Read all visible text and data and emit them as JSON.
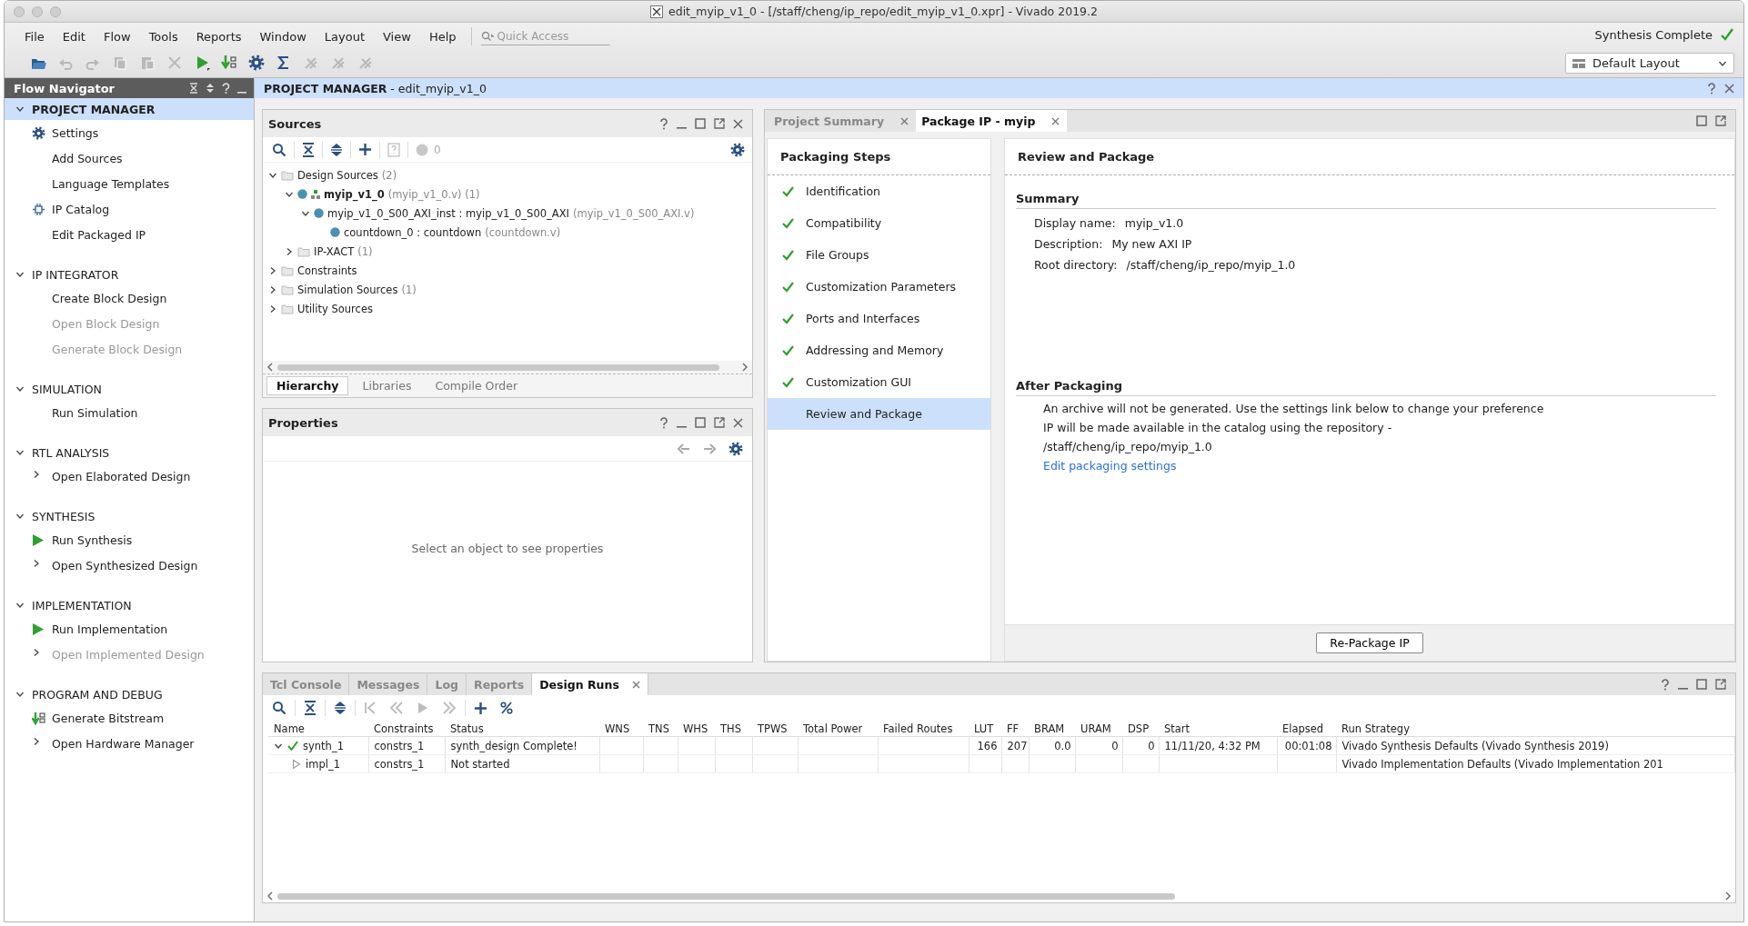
{
  "window": {
    "title": "edit_myip_v1_0 - [/staff/cheng/ip_repo/edit_myip_v1_0.xpr] - Vivado 2019.2"
  },
  "menu": [
    "File",
    "Edit",
    "Flow",
    "Tools",
    "Reports",
    "Window",
    "Layout",
    "View",
    "Help"
  ],
  "quick_access": {
    "placeholder": "Quick Access"
  },
  "toolbar": [
    {
      "kind": "open",
      "disabled": false
    },
    {
      "kind": "undo",
      "disabled": true
    },
    {
      "kind": "redo",
      "disabled": true
    },
    {
      "kind": "copy",
      "disabled": true
    },
    {
      "kind": "paste",
      "disabled": true
    },
    {
      "kind": "delete",
      "disabled": true
    },
    {
      "kind": "run",
      "disabled": false
    },
    {
      "kind": "bitstream",
      "disabled": false
    },
    {
      "kind": "settings",
      "disabled": false
    },
    {
      "kind": "sigma",
      "disabled": false
    },
    {
      "kind": "tool",
      "disabled": true
    },
    {
      "kind": "tool",
      "disabled": true
    },
    {
      "kind": "tool",
      "disabled": true
    }
  ],
  "status": {
    "text": "Synthesis Complete",
    "complete": true
  },
  "layout_select": {
    "value": "Default Layout"
  },
  "flow_navigator": {
    "title": "Flow Navigator",
    "sections": [
      {
        "label": "PROJECT MANAGER",
        "expanded": true,
        "selected": true,
        "items": [
          {
            "label": "Settings",
            "kind": "settings",
            "expandable": false,
            "disabled": false
          },
          {
            "label": "Add Sources",
            "kind": "plain",
            "expandable": false,
            "disabled": false
          },
          {
            "label": "Language Templates",
            "kind": "plain",
            "expandable": false,
            "disabled": false
          },
          {
            "label": "IP Catalog",
            "kind": "catalog",
            "expandable": false,
            "disabled": false
          },
          {
            "label": "Edit Packaged IP",
            "kind": "plain",
            "expandable": false,
            "disabled": false
          }
        ]
      },
      {
        "label": "IP INTEGRATOR",
        "expanded": true,
        "selected": false,
        "items": [
          {
            "label": "Create Block Design",
            "kind": "plain",
            "expandable": false,
            "disabled": false
          },
          {
            "label": "Open Block Design",
            "kind": "plain",
            "expandable": false,
            "disabled": true
          },
          {
            "label": "Generate Block Design",
            "kind": "plain",
            "expandable": false,
            "disabled": true
          }
        ]
      },
      {
        "label": "SIMULATION",
        "expanded": true,
        "selected": false,
        "items": [
          {
            "label": "Run Simulation",
            "kind": "plain",
            "expandable": false,
            "disabled": false
          }
        ]
      },
      {
        "label": "RTL ANALYSIS",
        "expanded": true,
        "selected": false,
        "items": [
          {
            "label": "Open Elaborated Design",
            "kind": "plain",
            "expandable": true,
            "disabled": false
          }
        ]
      },
      {
        "label": "SYNTHESIS",
        "expanded": true,
        "selected": false,
        "items": [
          {
            "label": "Run Synthesis",
            "kind": "run",
            "expandable": false,
            "disabled": false
          },
          {
            "label": "Open Synthesized Design",
            "kind": "plain",
            "expandable": true,
            "disabled": false
          }
        ]
      },
      {
        "label": "IMPLEMENTATION",
        "expanded": true,
        "selected": false,
        "items": [
          {
            "label": "Run Implementation",
            "kind": "run",
            "expandable": false,
            "disabled": false
          },
          {
            "label": "Open Implemented Design",
            "kind": "plain",
            "expandable": true,
            "disabled": true
          }
        ]
      },
      {
        "label": "PROGRAM AND DEBUG",
        "expanded": true,
        "selected": false,
        "items": [
          {
            "label": "Generate Bitstream",
            "kind": "bitstream",
            "expandable": false,
            "disabled": false
          },
          {
            "label": "Open Hardware Manager",
            "kind": "plain",
            "expandable": true,
            "disabled": false
          }
        ]
      }
    ]
  },
  "header": {
    "title": "PROJECT MANAGER",
    "subtitle": "- edit_myip_v1_0"
  },
  "sources": {
    "title": "Sources",
    "warning_count": "0",
    "tree": [
      {
        "label": "Design Sources",
        "detail": "(2)",
        "kind": "folder",
        "expanded": true,
        "children": [
          {
            "label": "myip_v1_0",
            "detail": "(myip_v1_0.v) (1)",
            "kind": "top",
            "expanded": true,
            "children": [
              {
                "label": "myip_v1_0_S00_AXI_inst : myip_v1_0_S00_AXI",
                "detail": "(myip_v1_0_S00_AXI.v)",
                "kind": "module",
                "expanded": true,
                "children": [
                  {
                    "label": "countdown_0 : countdown",
                    "detail": "(countdown.v)",
                    "kind": "module"
                  }
                ]
              }
            ]
          },
          {
            "label": "IP-XACT",
            "detail": "(1)",
            "kind": "folder",
            "expanded": false
          }
        ]
      },
      {
        "label": "Constraints",
        "kind": "folder",
        "expanded": false
      },
      {
        "label": "Simulation Sources",
        "detail": "(1)",
        "kind": "folder",
        "expanded": false
      },
      {
        "label": "Utility Sources",
        "kind": "folder",
        "expanded": false
      }
    ],
    "tabs": [
      {
        "label": "Hierarchy",
        "selected": true
      },
      {
        "label": "Libraries",
        "selected": false
      },
      {
        "label": "Compile Order",
        "selected": false
      }
    ]
  },
  "properties": {
    "title": "Properties",
    "message": "Select an object to see properties"
  },
  "package": {
    "tabs": [
      {
        "label": "Project Summary",
        "selected": false
      },
      {
        "label": "Package IP - myip",
        "selected": true
      }
    ],
    "steps_title": "Packaging Steps",
    "steps": [
      {
        "label": "Identification",
        "done": true,
        "selected": false
      },
      {
        "label": "Compatibility",
        "done": true,
        "selected": false
      },
      {
        "label": "File Groups",
        "done": true,
        "selected": false
      },
      {
        "label": "Customization Parameters",
        "done": true,
        "selected": false
      },
      {
        "label": "Ports and Interfaces",
        "done": true,
        "selected": false
      },
      {
        "label": "Addressing and Memory",
        "done": true,
        "selected": false
      },
      {
        "label": "Customization GUI",
        "done": true,
        "selected": false
      },
      {
        "label": "Review and Package",
        "done": false,
        "selected": true
      }
    ],
    "title": "Review and Package",
    "summary": {
      "heading": "Summary",
      "fields": [
        {
          "label": "Display name:",
          "value": "myip_v1.0"
        },
        {
          "label": "Description:",
          "value": "My new AXI IP"
        },
        {
          "label": "Root directory:",
          "value": "/staff/cheng/ip_repo/myip_1.0"
        }
      ]
    },
    "after": {
      "heading": "After Packaging",
      "lines": [
        "An archive will not be generated. Use the settings link below to change your preference",
        "IP will be made available in the catalog using the repository -",
        "/staff/cheng/ip_repo/myip_1.0"
      ],
      "link": "Edit packaging settings"
    },
    "button": "Re-Package IP"
  },
  "runs": {
    "tabs": [
      {
        "label": "Tcl Console",
        "selected": false
      },
      {
        "label": "Messages",
        "selected": false
      },
      {
        "label": "Log",
        "selected": false
      },
      {
        "label": "Reports",
        "selected": false
      },
      {
        "label": "Design Runs",
        "selected": true
      }
    ],
    "columns": [
      "Name",
      "Constraints",
      "Status",
      "WNS",
      "TNS",
      "WHS",
      "THS",
      "TPWS",
      "Total Power",
      "Failed Routes",
      "LUT",
      "FF",
      "BRAM",
      "URAM",
      "DSP",
      "Start",
      "Elapsed",
      "Run Strategy"
    ],
    "rows": [
      {
        "kind": "complete",
        "expanded": true,
        "cells": [
          "synth_1",
          "constrs_1",
          "synth_design Complete!",
          null,
          null,
          null,
          null,
          null,
          null,
          null,
          "166",
          "207",
          "0.0",
          "0",
          "0",
          "11/11/20, 4:32 PM",
          "00:01:08",
          "Vivado Synthesis Defaults (Vivado Synthesis 2019)"
        ],
        "children": [
          {
            "kind": "pending",
            "cells": [
              "impl_1",
              "constrs_1",
              "Not started",
              null,
              null,
              null,
              null,
              null,
              null,
              null,
              null,
              null,
              null,
              null,
              null,
              null,
              null,
              "Vivado Implementation Defaults (Vivado Implementation 201"
            ]
          }
        ]
      }
    ]
  }
}
